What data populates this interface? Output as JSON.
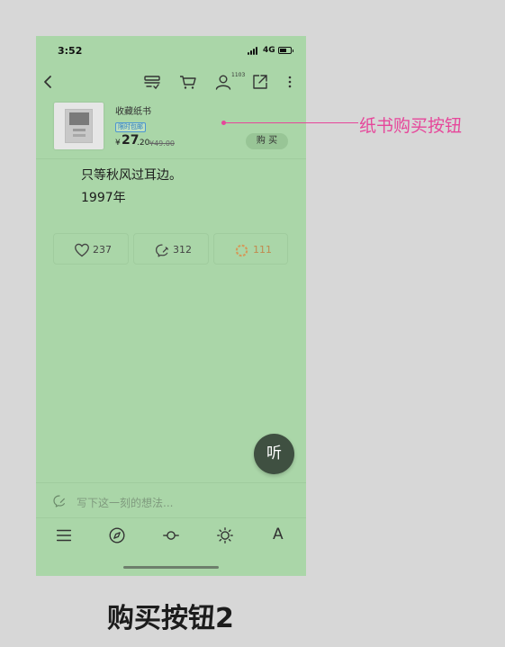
{
  "status": {
    "time": "3:52",
    "network": "4G"
  },
  "toolbar": {
    "friends_count": "1103"
  },
  "book": {
    "title": "收藏纸书",
    "promo_tag": "限时包邮",
    "price_symbol": "¥",
    "price_integer": "27",
    "price_decimal": ".20",
    "original_price": "¥49.00",
    "buy_label": "购 买"
  },
  "content": {
    "lines": [
      "只等秋风过耳边。",
      "1997年"
    ]
  },
  "stats": {
    "likes": "237",
    "comments": "312",
    "shares": "111"
  },
  "listen_button": {
    "label": "听"
  },
  "comment_input": {
    "placeholder": "写下这一刻的想法..."
  },
  "bottombar": {
    "font_label": "A"
  },
  "annotation": {
    "label": "纸书购买按钮",
    "caption": "购买按钮2"
  },
  "colors": {
    "background": "#aad6a8",
    "accent": "#e6469a",
    "fab": "#3f5041"
  }
}
